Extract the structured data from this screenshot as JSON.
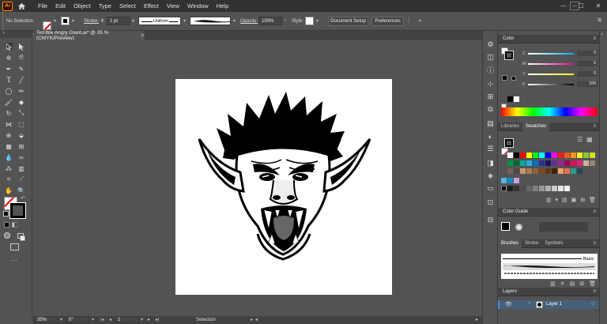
{
  "app": {
    "logo": "Ai",
    "title_tab": "Terrible Angry Giant.ai* @ 35 % (CMYK/Preview)"
  },
  "menu": [
    "File",
    "Edit",
    "Object",
    "Type",
    "Select",
    "Effect",
    "View",
    "Window",
    "Help"
  ],
  "control": {
    "selection": "No Selection",
    "stroke_label": "Stroke:",
    "stroke_value": "1 pt",
    "profile": "Uniform",
    "opacity_label": "Opacity:",
    "opacity_value": "100%",
    "style_label": "Style:",
    "document_setup": "Document Setup",
    "preferences": "Preferences"
  },
  "status": {
    "zoom": "35%",
    "rotation": "0°",
    "artboard": "1",
    "mode": "Selection"
  },
  "color_panel": {
    "title": "Color",
    "channels": [
      {
        "label": "C",
        "value": "0",
        "unit": "%"
      },
      {
        "label": "M",
        "value": "0",
        "unit": "%"
      },
      {
        "label": "Y",
        "value": "0",
        "unit": "%"
      },
      {
        "label": "K",
        "value": "100",
        "unit": "%"
      }
    ]
  },
  "swatches_panel": {
    "tabs": [
      "Libraries",
      "Swatches"
    ]
  },
  "color_guide": {
    "title": "Color Guide"
  },
  "brushes_panel": {
    "tabs": [
      "Brushes",
      "Stroke",
      "Symbols"
    ],
    "basic_label": "Basic"
  },
  "layers_panel": {
    "title": "Layers",
    "layer_name": "Layer 1"
  },
  "colors": {
    "accent": "#ff9a00",
    "ui_dark": "#323232",
    "ui_mid": "#535353",
    "layer_select": "#46607a"
  },
  "swatch_rows": [
    [
      "#ffffff",
      "#000000",
      "#ff0000",
      "#ffff00",
      "#00ff00",
      "#00ffff",
      "#0000ff",
      "#ff00ff",
      "#ed1c24",
      "#f15a24",
      "#f7931e",
      "#fcee21",
      "#8cc63f",
      "#d9e021"
    ],
    [
      "#009245",
      "#006837",
      "#00a99d",
      "#29abe2",
      "#0071bc",
      "#2e3192",
      "#1b1464",
      "#662d91",
      "#93278f",
      "#9e005d",
      "#d4145a",
      "#ed1e79",
      "#c7b299",
      "#998675"
    ],
    [
      "#736357",
      "#534741",
      "#c69c6d",
      "#a67c52",
      "#8c6239",
      "#754c24",
      "#603813",
      "#42210b",
      "#f4a261",
      "#e76f51",
      "#2a9d8f",
      "#264653"
    ]
  ]
}
